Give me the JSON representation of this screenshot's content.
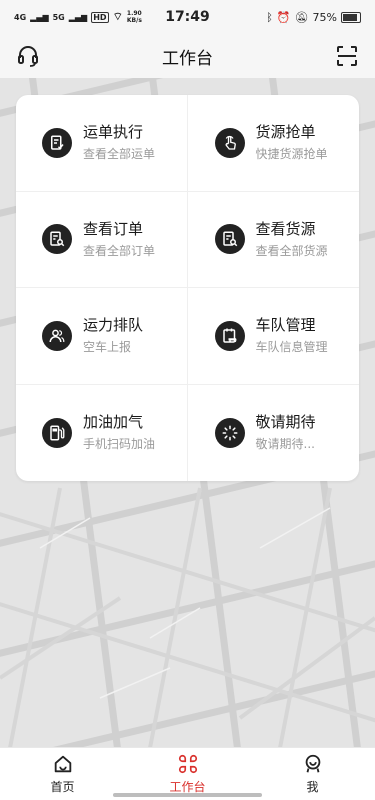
{
  "status_bar": {
    "signal1": "4G",
    "signal2": "5G",
    "hd": "HD",
    "speed": "1.90 KB/s",
    "time": "17:49",
    "battery": "75%"
  },
  "header": {
    "title": "工作台",
    "left_icon": "headset-icon",
    "right_icon": "scan-icon"
  },
  "menu": [
    {
      "title": "运单执行",
      "subtitle": "查看全部运单",
      "icon": "waybill-icon"
    },
    {
      "title": "货源抢单",
      "subtitle": "快捷货源抢单",
      "icon": "tap-hand-icon"
    },
    {
      "title": "查看订单",
      "subtitle": "查看全部订单",
      "icon": "order-search-icon"
    },
    {
      "title": "查看货源",
      "subtitle": "查看全部货源",
      "icon": "cargo-search-icon"
    },
    {
      "title": "运力排队",
      "subtitle": "空车上报",
      "icon": "people-icon"
    },
    {
      "title": "车队管理",
      "subtitle": "车队信息管理",
      "icon": "fleet-icon"
    },
    {
      "title": "加油加气",
      "subtitle": "手机扫码加油",
      "icon": "fuel-pump-icon"
    },
    {
      "title": "敬请期待",
      "subtitle": "敬请期待...",
      "icon": "loading-icon"
    }
  ],
  "tabs": [
    {
      "label": "首页",
      "icon": "home-icon"
    },
    {
      "label": "工作台",
      "icon": "workbench-icon",
      "active": true
    },
    {
      "label": "我",
      "icon": "profile-icon"
    }
  ],
  "colors": {
    "accent": "#d9302c",
    "icon_bg": "#222222"
  }
}
